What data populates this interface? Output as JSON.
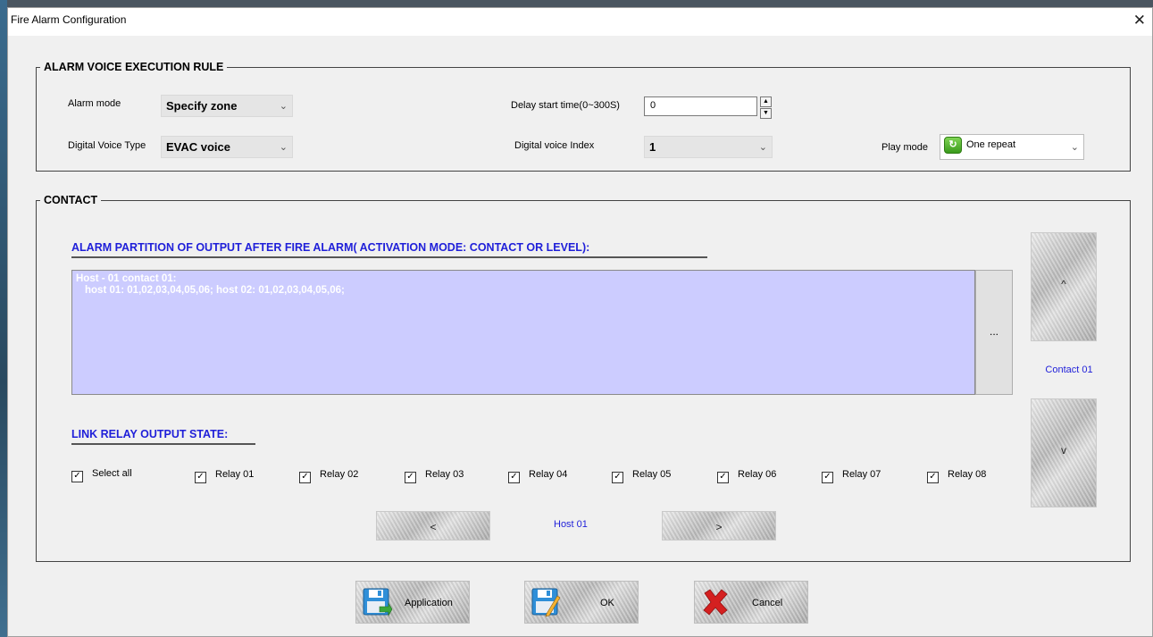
{
  "window": {
    "title": "Fire Alarm Configuration",
    "close_glyph": "✕"
  },
  "voice_rule": {
    "legend": "ALARM VOICE EXECUTION RULE",
    "alarm_mode_label": "Alarm mode",
    "alarm_mode_value": "Specify zone",
    "delay_label": "Delay start time(0~300S)",
    "delay_value": "0",
    "voice_type_label": "Digital Voice Type",
    "voice_type_value": "EVAC voice",
    "voice_index_label": "Digital voice Index",
    "voice_index_value": "1",
    "play_mode_label": "Play mode",
    "play_mode_value": "One repeat",
    "play_mode_icon": "repeat-once-icon"
  },
  "contact": {
    "legend": "CONTACT",
    "partition_heading": "ALARM PARTITION OF OUTPUT AFTER FIRE ALARM( ACTIVATION MODE: CONTACT OR LEVEL):",
    "partition_line1": "Host - 01 contact 01:",
    "partition_line2": "host 01: 01,02,03,04,05,06;  host 02: 01,02,03,04,05,06;",
    "browse_label": "...",
    "contact_up": "^",
    "contact_down": "v",
    "contact_label": "Contact 01",
    "relay_heading": "LINK RELAY OUTPUT STATE:",
    "select_all": "Select all",
    "relays": [
      "Relay 01",
      "Relay 02",
      "Relay 03",
      "Relay 04",
      "Relay 05",
      "Relay 06",
      "Relay 07",
      "Relay 08"
    ],
    "checked_mark": "✓",
    "host_prev": "<",
    "host_next": ">",
    "host_label": "Host 01"
  },
  "footer": {
    "apply_label": "Application",
    "ok_label": "OK",
    "cancel_label": "Cancel",
    "apply_icon": "save-icon",
    "ok_icon": "save-edit-icon",
    "cancel_icon": "red-x-icon"
  }
}
